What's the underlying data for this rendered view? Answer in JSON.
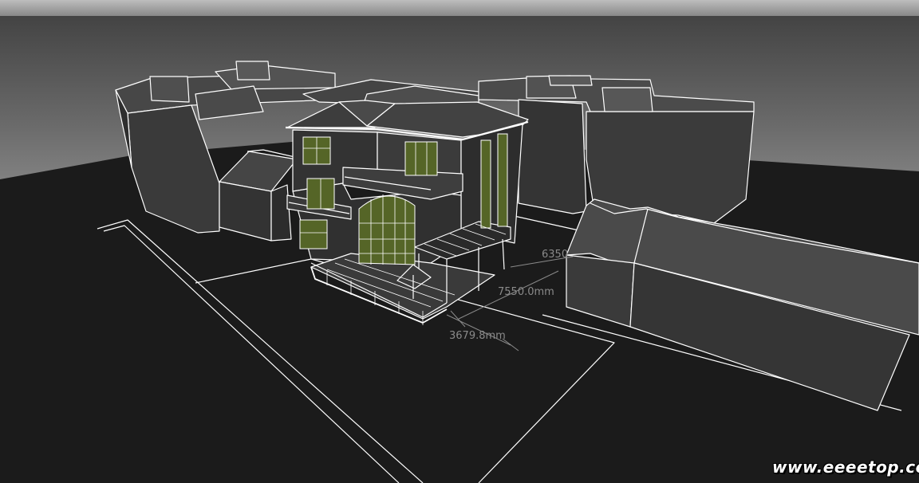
{
  "viewport": {
    "background_sky_top": "#4a4a4a",
    "background_sky_horizon": "#8a8a8a",
    "ground_color": "#1b1b1b",
    "edge_color": "#ffffff",
    "glass_color": "#5c6b2e"
  },
  "dimensions": [
    {
      "id": "dim-6350",
      "label": "6350"
    },
    {
      "id": "dim-7550",
      "label": "7550.0mm"
    },
    {
      "id": "dim-3679",
      "label": "3679.8mm"
    }
  ],
  "watermark": "www.eeeetop.com"
}
